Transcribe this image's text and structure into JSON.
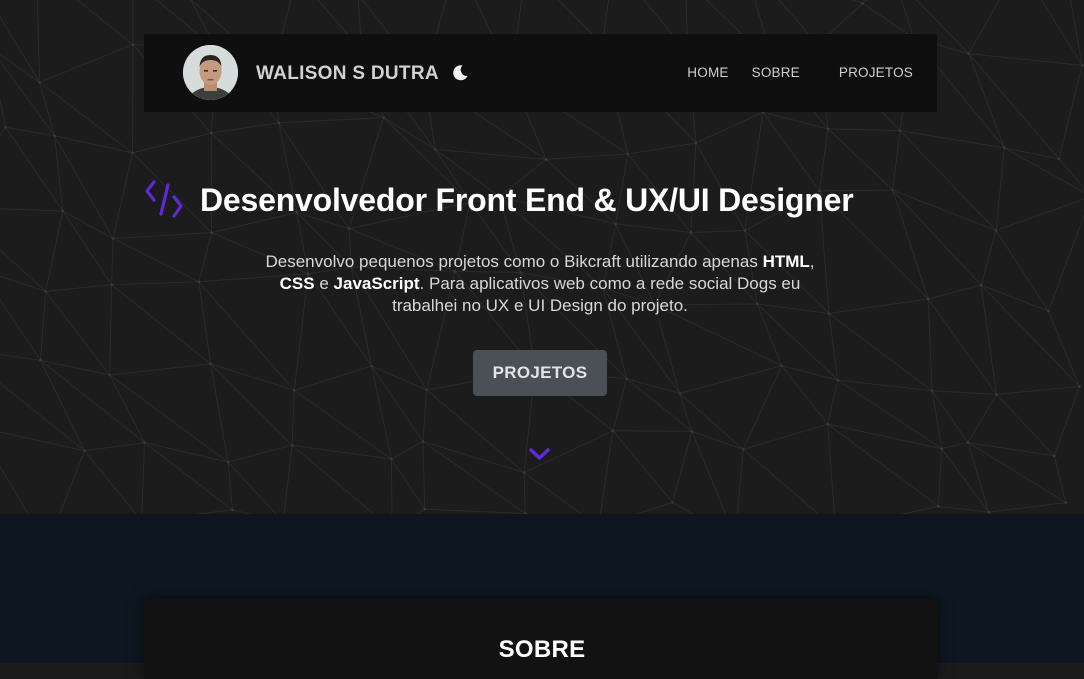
{
  "header": {
    "name": "WALISON S DUTRA",
    "nav": {
      "home": "HOME",
      "sobre": "SOBRE",
      "projetos": "PROJETOS"
    }
  },
  "hero": {
    "headline": "Desenvolvedor Front End & UX/UI Designer",
    "intro": {
      "p1": "Desenvolvo pequenos projetos como o Bikcraft utilizando apenas ",
      "html": "HTML",
      "sep1": ", ",
      "css": "CSS",
      "sep2": " e ",
      "js": "JavaScript",
      "p2": ". Para aplicativos web como a rede social Dogs eu trabalhei no UX e UI Design do projeto."
    },
    "cta": "PROJETOS"
  },
  "about": {
    "title": "SOBRE"
  },
  "icons": {
    "theme_toggle": "moon-icon",
    "code": "code-icon",
    "scroll": "chevron-down-icon"
  },
  "colors": {
    "accent": "#5b2bd6",
    "hero_bg": "#1c1c1c",
    "header_bg": "#0f0f0f",
    "button_bg": "#4b4f56",
    "about_bg": "#0e1621"
  }
}
